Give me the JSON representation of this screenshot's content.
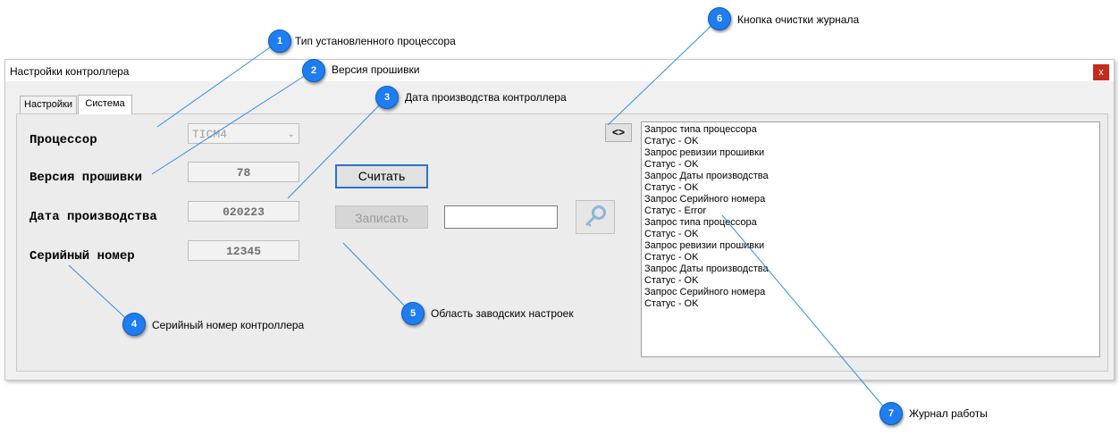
{
  "window": {
    "title": "Настройки контроллера",
    "close_label": "x"
  },
  "tabs": [
    {
      "label": "Настройки"
    },
    {
      "label": "Система"
    }
  ],
  "form": {
    "processor_label": "Процессор",
    "processor_value": "TICM4",
    "firmware_label": "Версия прошивки",
    "firmware_value": "78",
    "date_label": "Дата производства",
    "date_value": "020223",
    "serial_label": "Серийный номер",
    "serial_value": "12345",
    "read_button": "Считать",
    "write_button": "Записать",
    "password_value": ""
  },
  "log_toggle_label": "<>",
  "log_lines": [
    "Запрос типа процессора",
    "Статус - OK",
    "Запрос ревизии прошивки",
    "Статус - OK",
    "Запрос Даты производства",
    "Статус - OK",
    "Запрос Серийного номера",
    "Статус - Error",
    "Запрос типа процессора",
    "Статус - OK",
    "Запрос ревизии прошивки",
    "Статус - OK",
    "Запрос Даты производства",
    "Статус - OK",
    "Запрос Серийного номера",
    "Статус - OK"
  ],
  "callouts": [
    {
      "num": "1",
      "text": "Тип установленного процессора"
    },
    {
      "num": "2",
      "text": "Версия прошивки"
    },
    {
      "num": "3",
      "text": "Дата производства контроллера"
    },
    {
      "num": "4",
      "text": "Серийный номер контроллера"
    },
    {
      "num": "5",
      "text": "Область заводских настроек"
    },
    {
      "num": "6",
      "text": "Кнопка очистки журнала"
    },
    {
      "num": "7",
      "text": "Журнал работы"
    }
  ],
  "colors": {
    "callout": "#1e7df0",
    "leader_line": "#2f8de4",
    "close_button": "#c42b1c"
  }
}
